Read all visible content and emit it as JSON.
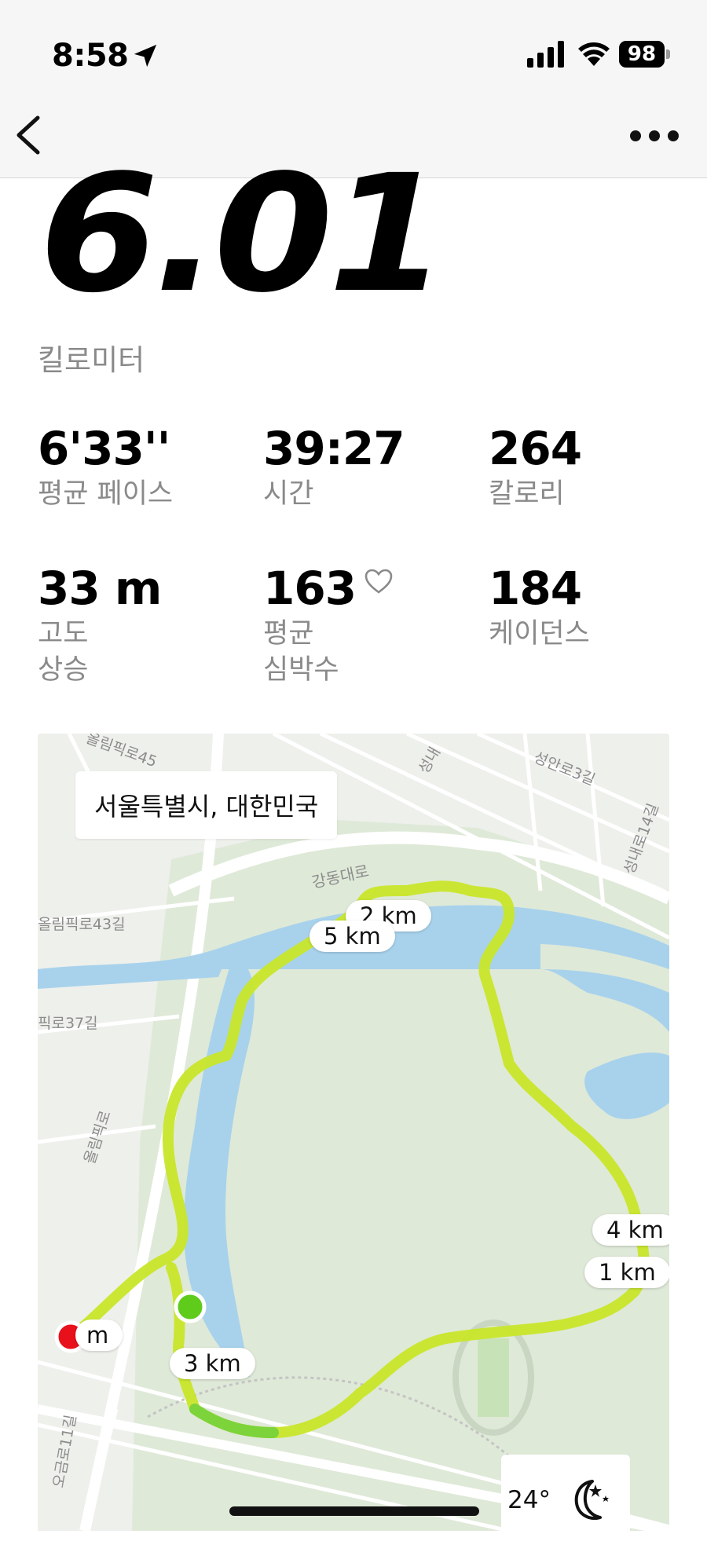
{
  "status_bar": {
    "time": "8:58",
    "battery": "98",
    "icons": [
      "location-arrow-icon",
      "signal-bars-icon",
      "wifi-icon",
      "battery-icon"
    ]
  },
  "nav": {
    "back_icon": "chevron-left-icon",
    "more_icon": "ellipsis-icon"
  },
  "summary": {
    "distance": "6.01",
    "distance_unit": "킬로미터"
  },
  "stats": [
    {
      "value": "6'33''",
      "label": "평균 페이스"
    },
    {
      "value": "39:27",
      "label": "시간"
    },
    {
      "value": "264",
      "label": "칼로리"
    },
    {
      "value": "33 m",
      "label": "고도\n상승"
    },
    {
      "value": "163",
      "label": "평균\n심박수",
      "icon": "heart-icon"
    },
    {
      "value": "184",
      "label": "케이던스"
    }
  ],
  "map": {
    "location": "서울특별시, 대한민국",
    "streets": [
      "올림픽로45",
      "올림픽로43길",
      "픽로37길",
      "올림픽로",
      "강동대로",
      "성안로3길",
      "성내로14길",
      "성내",
      "오금로11길"
    ],
    "km_markers": [
      "2 km",
      "5 km",
      "4 km",
      "1 km",
      "3 km",
      "m"
    ],
    "weather": {
      "temp": "24°",
      "icon": "moon-stars-icon"
    },
    "colors": {
      "route": "#c8e62a",
      "start": "#5fcc1c",
      "end": "#e8101a",
      "water": "#a8d2ec",
      "park": "#dfe9d8"
    }
  }
}
